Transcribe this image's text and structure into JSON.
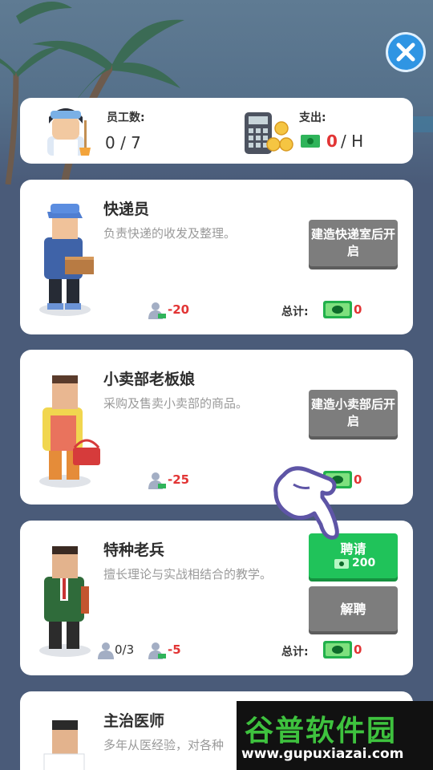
{
  "summary": {
    "staff_label": "员工数:",
    "staff_value": "0 / 7",
    "expense_label": "支出:",
    "expense_value": "0",
    "expense_unit": "/ H"
  },
  "workers": [
    {
      "name": "快递员",
      "description": "负责快递的收发及整理。",
      "button_label": "建造快递室后开启",
      "salary": "-20",
      "total_label": "总计:",
      "total_value": "0"
    },
    {
      "name": "小卖部老板娘",
      "description": "采购及售卖小卖部的商品。",
      "button_label": "建造小卖部后开启",
      "salary": "-25",
      "total_value": "0"
    },
    {
      "name": "特种老兵",
      "description": "擅长理论与实战相结合的教学。",
      "hire_label": "聘请",
      "hire_cost": "200",
      "fire_label": "解聘",
      "count": "0/3",
      "salary": "-5",
      "total_label": "总计:",
      "total_value": "0"
    },
    {
      "name": "主治医师",
      "description": "多年从医经验，对各种"
    }
  ],
  "watermark": {
    "title": "谷普软件园",
    "url": "www.gupuxiazai.com"
  },
  "colors": {
    "accent_green": "#20c35a",
    "negative_red": "#e23535",
    "close_blue": "#2f95e3",
    "background": "#4a5b79"
  }
}
